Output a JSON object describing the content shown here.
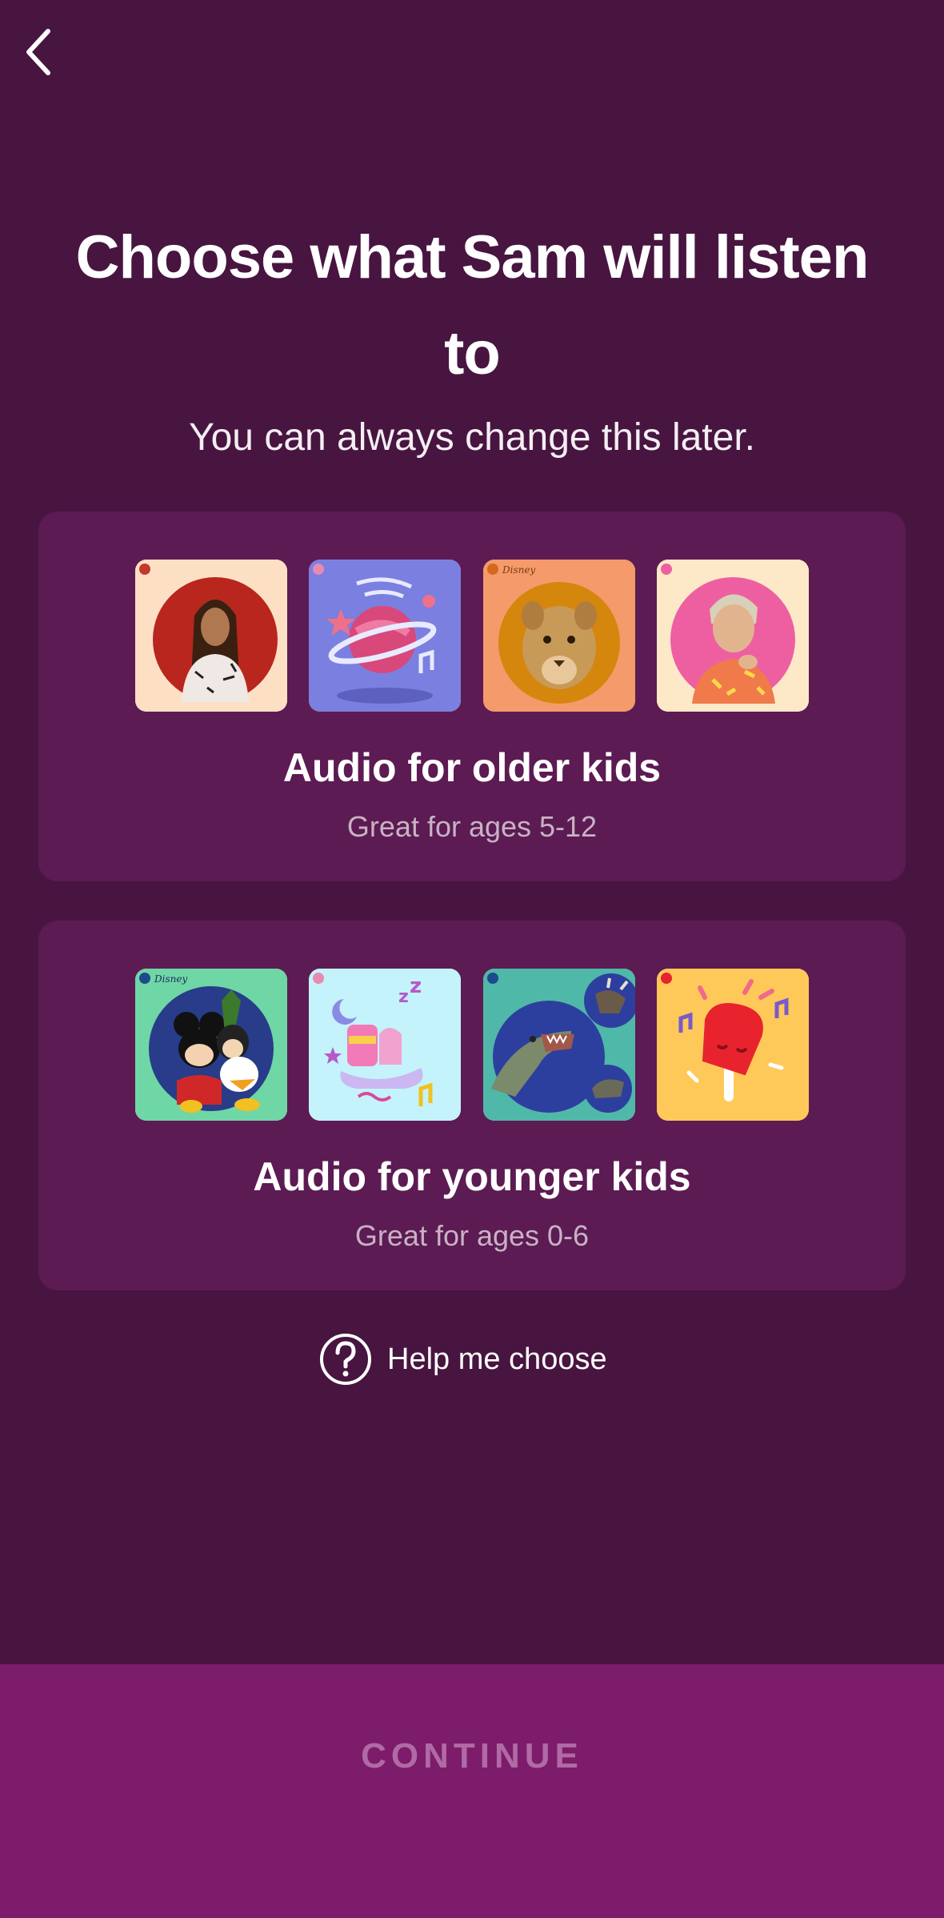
{
  "header": {
    "back_icon": "chevron-left-icon"
  },
  "page": {
    "title": "Choose what Sam will listen to",
    "subtitle": "You can always change this later."
  },
  "options": [
    {
      "title": "Audio for older kids",
      "subtitle": "Great for ages 5-12",
      "thumbnails": [
        "artist-portrait-woman",
        "planet-illustration",
        "lion-cub-disney",
        "artist-portrait-man"
      ],
      "colors": [
        "#fde0c4",
        "#7b7fe0",
        "#f59a6a",
        "#fde9c8"
      ]
    },
    {
      "title": "Audio for younger kids",
      "subtitle": "Great for ages 0-6",
      "thumbnails": [
        "disney-characters",
        "sleeping-bed-illustration",
        "dinosaurs",
        "popsicle-illustration"
      ],
      "colors": [
        "#6fd6a6",
        "#c4f3fb",
        "#4fb8a8",
        "#ffc95a"
      ]
    }
  ],
  "help": {
    "label": "Help me choose",
    "icon": "question-circle-icon"
  },
  "footer": {
    "continue_label": "CONTINUE"
  },
  "colors": {
    "background": "#471540",
    "card": "#5c1b53",
    "footer": "#7d1c6b",
    "continue_disabled_text": "#b06aa5"
  }
}
